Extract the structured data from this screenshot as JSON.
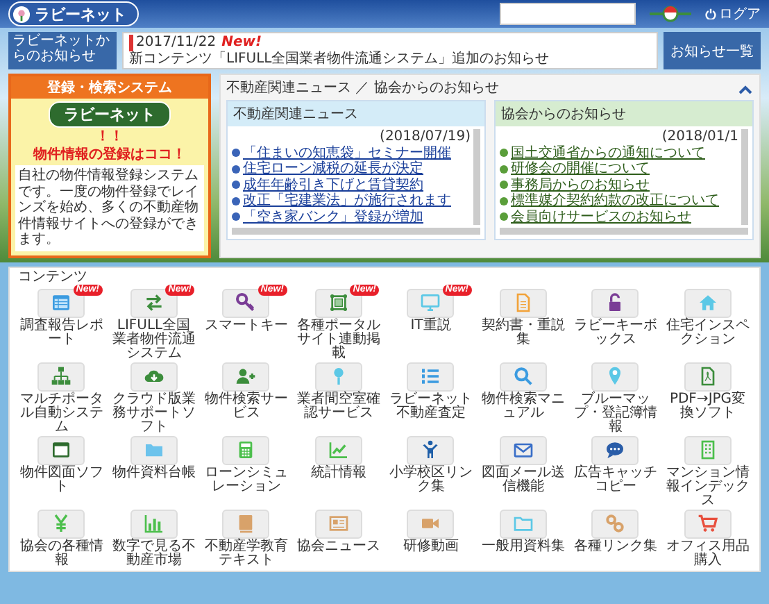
{
  "header": {
    "site_name": "ラビーネット",
    "logout": "ログア"
  },
  "ticker": {
    "label": "ラビーネットからのお知らせ",
    "date": "2017/11/22",
    "new_mark": "New!",
    "text": "新コンテンツ「LIFULL全国業者物件流通システム」追加のお知らせ",
    "button": "お知らせ一覧"
  },
  "promo": {
    "title": "登録・検索システム",
    "logo": "ラビーネット",
    "exclaim": "！！",
    "headline": "物件情報の登録はココ！",
    "description": "自社の物件情報登録システムです。一度の物件登録でレインズを始め、多くの不動産物件情報サイトへの登録ができます。"
  },
  "news_panel": {
    "title": "不動産関連ニュース ／ 協会からのお知らせ",
    "expanded": true,
    "boxes": [
      {
        "title": "不動産関連ニュース",
        "date": "(2018/07/19)",
        "items": [
          "「住まいの知恵袋」セミナー開催",
          "住宅ローン減税の延長が決定",
          "成年年齢引き下げと賃貸契約",
          "改正「宅建業法」が施行されます",
          "「空き家バンク」登録が増加"
        ]
      },
      {
        "title": "協会からのお知らせ",
        "date": "(2018/01/1",
        "items": [
          "国土交通省からの通知について",
          "研修会の開催について",
          "事務局からのお知らせ",
          "標準媒介契約約款の改正について",
          "会員向けサービスのお知らせ"
        ]
      }
    ]
  },
  "contents": {
    "title": "コンテンツ",
    "items": [
      {
        "label": "調査報告レポート",
        "badge": "New!"
      },
      {
        "label": "LIFULL全国業者物件流通システム",
        "badge": "New!"
      },
      {
        "label": "スマートキー",
        "badge": "New!"
      },
      {
        "label": "各種ポータルサイト連動掲載",
        "badge": "New!"
      },
      {
        "label": "IT重説",
        "badge": "New!"
      },
      {
        "label": "契約書・重説集"
      },
      {
        "label": "ラビーキーボックス"
      },
      {
        "label": "住宅インスペクション"
      },
      {
        "label": "マルチポータル自動システム"
      },
      {
        "label": "クラウド版業務サポートソフト"
      },
      {
        "label": "物件検索サービス"
      },
      {
        "label": "業者間空室確認サービス"
      },
      {
        "label": "ラビーネット不動産査定"
      },
      {
        "label": "物件検索マニュアル"
      },
      {
        "label": "ブルーマップ・登記簿情報"
      },
      {
        "label": "PDF→JPG変換ソフト"
      },
      {
        "label": "物件図面ソフト"
      },
      {
        "label": "物件資料台帳"
      },
      {
        "label": "ローンシミュレーション"
      },
      {
        "label": "統計情報"
      },
      {
        "label": "小学校区リンク集"
      },
      {
        "label": "図面メール送信機能"
      },
      {
        "label": "広告キャッチコピー"
      },
      {
        "label": "マンション情報インデックス"
      },
      {
        "label": "協会の各種情報"
      },
      {
        "label": "数字で見る不動産市場"
      },
      {
        "label": "不動産学教育テキスト"
      },
      {
        "label": "協会ニュース"
      },
      {
        "label": "研修動画"
      },
      {
        "label": "一般用資料集"
      },
      {
        "label": "各種リンク集"
      },
      {
        "label": "オフィス用品購入"
      }
    ]
  }
}
